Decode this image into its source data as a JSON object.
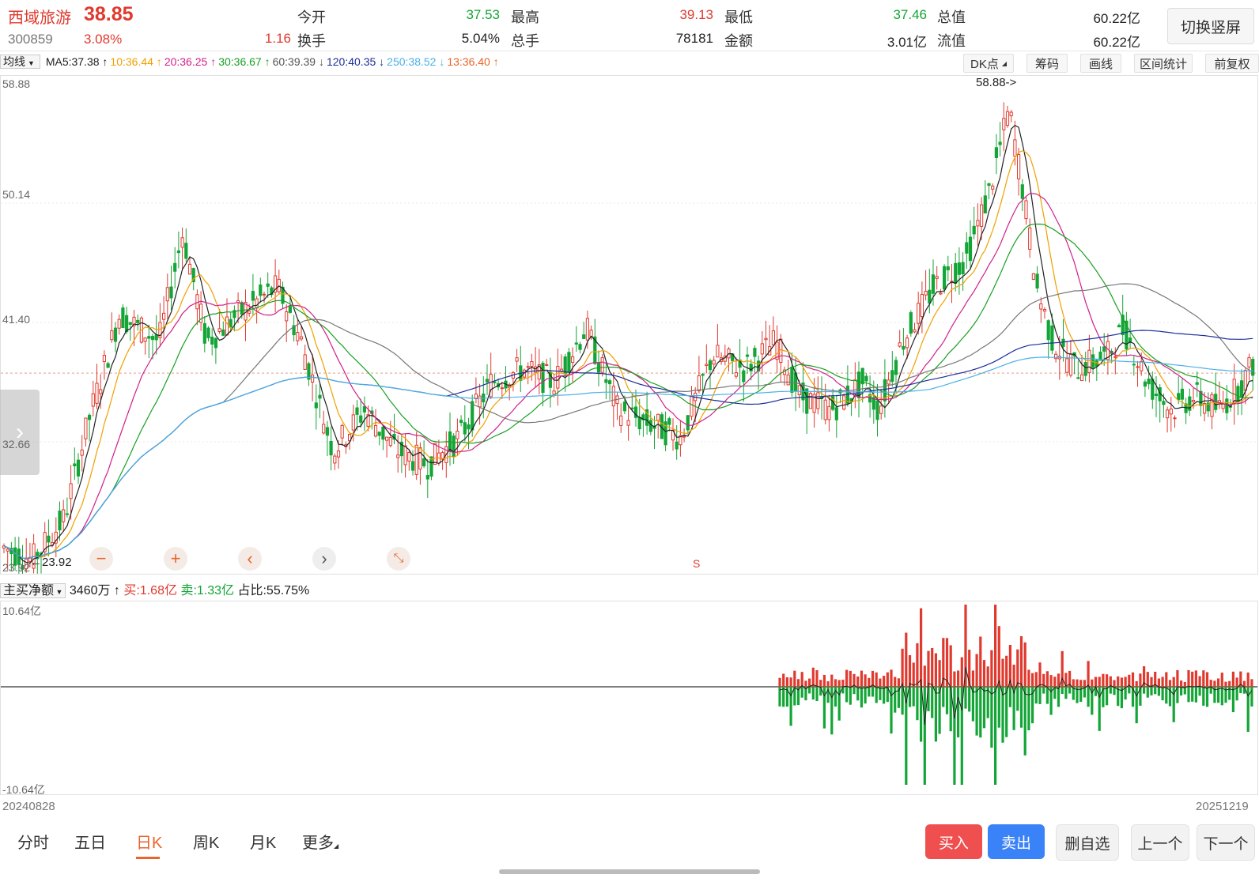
{
  "header": {
    "stock_name": "西域旅游",
    "price": "38.85",
    "code": "300859",
    "change_pct": "3.08%",
    "change": "1.16",
    "quote_rows": [
      [
        {
          "label": "今开",
          "value": "37.53",
          "color": "green"
        },
        {
          "label": "最高",
          "value": "39.13",
          "color": "red"
        },
        {
          "label": "最低",
          "value": "37.46",
          "color": "green"
        },
        {
          "label": "总值",
          "value": "60.22亿",
          "color": "dark"
        }
      ],
      [
        {
          "label": "换手",
          "value": "5.04%",
          "color": "dark"
        },
        {
          "label": "总手",
          "value": "78181",
          "color": "dark"
        },
        {
          "label": "金额",
          "value": "3.01亿",
          "color": "dark"
        },
        {
          "label": "流值",
          "value": "60.22亿",
          "color": "dark"
        }
      ]
    ],
    "switch_label": "切换竖屏"
  },
  "ma_bar": {
    "selector": "均线",
    "items": [
      {
        "text": "MA5:37.38 ↑",
        "color": "#222222"
      },
      {
        "text": "10:36.44 ↑",
        "color": "#f0a000"
      },
      {
        "text": "20:36.25 ↑",
        "color": "#d0208a"
      },
      {
        "text": "30:36.67 ↑",
        "color": "#18a020"
      },
      {
        "text": "60:39.39 ↓",
        "color": "#555555"
      },
      {
        "text": "120:40.35 ↓",
        "color": "#1a2e9a"
      },
      {
        "text": "250:38.52 ↓",
        "color": "#4ab0e8"
      },
      {
        "text": "13:36.40 ↑",
        "color": "#e8642a"
      }
    ],
    "tools": [
      "DK点",
      "筹码",
      "画线",
      "区间统计",
      "前复权"
    ]
  },
  "price_axis": [
    "58.88",
    "50.14",
    "41.40",
    "32.66",
    "23.92"
  ],
  "max_marker": "58.88->",
  "min_marker": "23.92",
  "chart_marker_s": "S",
  "indicator": {
    "selector": "主买净额",
    "value": "3460万 ↑",
    "buy": "买:1.68亿",
    "sell": "卖:1.33亿",
    "ratio": "占比:55.75%",
    "axis_top": "10.64亿",
    "axis_bottom": "-10.64亿"
  },
  "dates": {
    "start": "20240828",
    "end": "20251219"
  },
  "tabs": [
    "分时",
    "五日",
    "日K",
    "周K",
    "月K",
    "更多"
  ],
  "active_tab": "日K",
  "buttons": {
    "buy": "买入",
    "sell": "卖出",
    "remove": "删自选",
    "prev": "上一个",
    "next": "下一个"
  },
  "colors": {
    "up": "#e03a2f",
    "down": "#13a536",
    "accent": "#e8642a",
    "blue": "#3a82f7"
  }
}
